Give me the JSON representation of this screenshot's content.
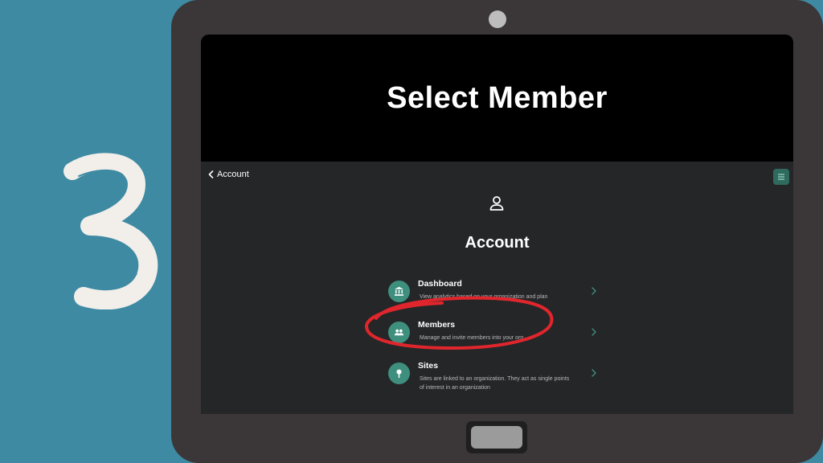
{
  "step": {
    "number": "3"
  },
  "banner": {
    "title": "Select Member"
  },
  "app": {
    "back_label": "Account",
    "page_title": "Account",
    "menu": [
      {
        "title": "Dashboard",
        "description": "View analytics based on your organization and plan",
        "icon": "bank-icon"
      },
      {
        "title": "Members",
        "description": "Manage and invite members into your org",
        "icon": "users-icon"
      },
      {
        "title": "Sites",
        "description": "Sites are linked to an organization. They act as single points of interest in an organization",
        "icon": "pin-icon"
      }
    ]
  },
  "colors": {
    "background": "#3e8aa3",
    "tablet": "#3b3637",
    "app_bg": "#252628",
    "accent": "#3e8f7e",
    "annotation": "#e0262c"
  }
}
